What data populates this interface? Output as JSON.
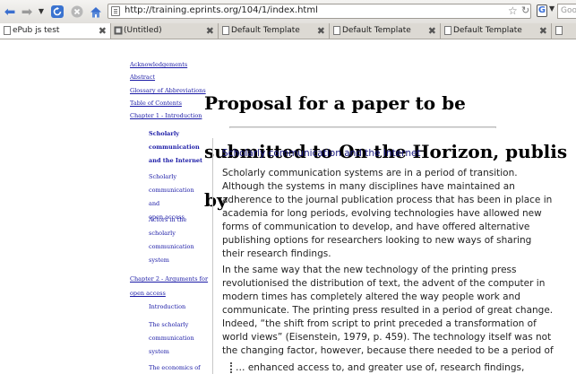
{
  "toolbar": {
    "url": "http://training.eprints.org/104/1/index.html",
    "search_placeholder": "Goog",
    "search_engine_letter": "G"
  },
  "tabs": [
    {
      "label": "ePub js test",
      "active": true
    },
    {
      "label": "(Untitled)",
      "active": false
    },
    {
      "label": "Default Template",
      "active": false
    },
    {
      "label": "Default Template",
      "active": false
    },
    {
      "label": "Default Template",
      "active": false
    }
  ],
  "sidebar": {
    "links": [
      "Acknowledgements",
      "Abstract",
      "Glossary of Abbreviations",
      "Table of Contents",
      "Chapter 1 - Introduction"
    ],
    "ch1_subs": [
      {
        "lines": [
          "Scholarly",
          "communication",
          "and the Internet"
        ],
        "bold": true
      },
      {
        "lines": [
          "Scholarly",
          "communication and",
          "open access"
        ],
        "bold": false
      },
      {
        "lines": [
          "Actors in the",
          "scholarly",
          "communication",
          "system"
        ],
        "bold": false
      }
    ],
    "ch2_lines": [
      "Chapter 2 - Arguments for",
      "open access"
    ],
    "ch2_subs": [
      {
        "lines": [
          "Introduction"
        ]
      },
      {
        "lines": [
          "The scholarly",
          "communication",
          "system"
        ]
      },
      {
        "lines": [
          "The economics of"
        ]
      }
    ]
  },
  "document": {
    "title_lines": [
      "Proposal for a paper to be",
      "submitted to On the Horizon, publis",
      "by"
    ],
    "section_heading": "Scholarly communication and the Internet",
    "para1": [
      "Scholarly communication systems are in a period of transition.",
      "Although the systems in many disciplines have maintained an",
      "adherence to the journal publication process that has been in place in",
      "academia for long periods, evolving technologies have allowed new",
      "forms of communication to develop, and have offered alternative",
      "publishing options for researchers looking to new ways of sharing",
      "their research findings."
    ],
    "para2": [
      "In the same way that the new technology of the printing press",
      "revolutionised the distribution of text, the advent of the computer in",
      "modern times has completely altered the way people work and",
      "communicate. The printing press resulted in a period of great change.",
      "Indeed, “the shift from script to print preceded a transformation of",
      "world views” (Eisenstein, 1979, p. 459). The technology itself was not",
      "the changing factor, however, because there needed to be a period of"
    ],
    "quote": "… enhanced access to, and greater use of, research findings,"
  },
  "colors": {
    "link": "#1a1aa6",
    "heading": "#1a1a80",
    "body_text": "#222222"
  }
}
